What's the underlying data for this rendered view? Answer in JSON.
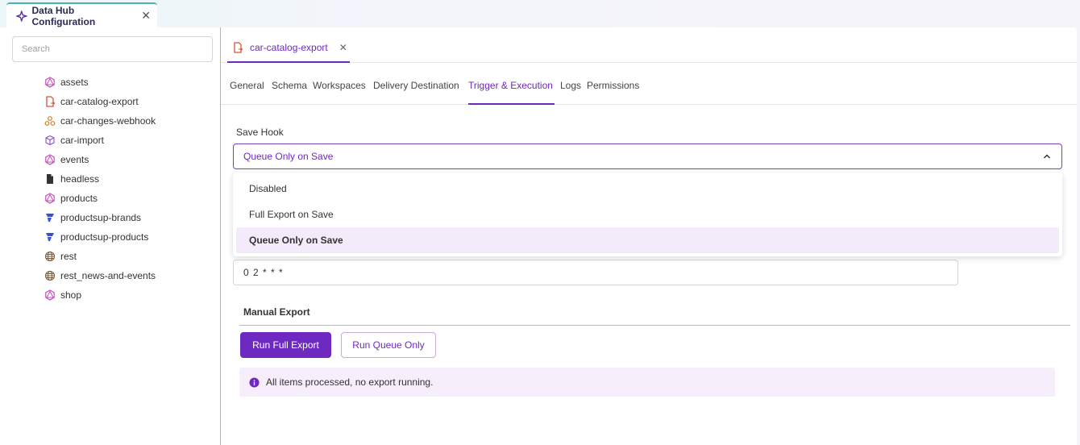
{
  "app_tab": {
    "title": "Data Hub Configuration",
    "close": "✕"
  },
  "search": {
    "placeholder": "Search",
    "value": ""
  },
  "tree": [
    {
      "label": "assets",
      "icon": "graphql-icon"
    },
    {
      "label": "car-catalog-export",
      "icon": "file-export-icon"
    },
    {
      "label": "car-changes-webhook",
      "icon": "webhook-icon"
    },
    {
      "label": "car-import",
      "icon": "cube-import-icon"
    },
    {
      "label": "events",
      "icon": "graphql-icon"
    },
    {
      "label": "headless",
      "icon": "document-icon"
    },
    {
      "label": "products",
      "icon": "graphql-icon"
    },
    {
      "label": "productsup-brands",
      "icon": "productsup-icon"
    },
    {
      "label": "productsup-products",
      "icon": "productsup-icon"
    },
    {
      "label": "rest",
      "icon": "globe-icon"
    },
    {
      "label": "rest_news-and-events",
      "icon": "globe-icon"
    },
    {
      "label": "shop",
      "icon": "graphql-icon"
    }
  ],
  "doc_tab": {
    "label": "car-catalog-export",
    "close": "✕"
  },
  "sub_tabs": [
    {
      "label": "General",
      "active": false
    },
    {
      "label": "Schema",
      "active": false
    },
    {
      "label": "Workspaces",
      "active": false
    },
    {
      "label": "Delivery Destination",
      "active": false
    },
    {
      "label": "Trigger & Execution",
      "active": true
    },
    {
      "label": "Logs",
      "active": false
    },
    {
      "label": "Permissions",
      "active": false
    }
  ],
  "save_hook": {
    "label": "Save Hook",
    "selected": "Queue Only on Save",
    "options": [
      "Disabled",
      "Full Export on Save",
      "Queue Only on Save"
    ]
  },
  "cron": {
    "value": "0 2 * * *"
  },
  "manual_export": {
    "title": "Manual Export",
    "run_full_label": "Run Full Export",
    "run_queue_label": "Run Queue Only"
  },
  "status": {
    "message": "All items processed, no export running."
  },
  "colors": {
    "accent": "#6e2ac0",
    "light_accent": "#f6eefb",
    "teal": "#4bb3a8"
  }
}
